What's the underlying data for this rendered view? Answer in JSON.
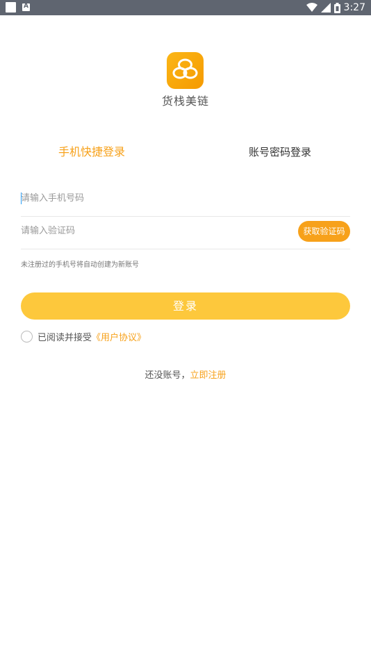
{
  "statusbar": {
    "time": "3:27"
  },
  "brand": {
    "name": "货栈美链"
  },
  "tabs": [
    {
      "label": "手机快捷登录",
      "active": true
    },
    {
      "label": "账号密码登录",
      "active": false
    }
  ],
  "phone": {
    "placeholder": "请输入手机号码",
    "value": ""
  },
  "code": {
    "placeholder": "请输入验证码",
    "value": "",
    "button_label": "获取验证码"
  },
  "hint": "未注册过的手机号将自动创建为新账号",
  "login": {
    "label": "登录"
  },
  "agreement": {
    "prefix": "已阅读并接受",
    "link": "《用户协议》"
  },
  "register": {
    "prefix": "还没账号，",
    "link": "立即注册"
  },
  "colors": {
    "accent": "#f7a11a",
    "button": "#fdc83c",
    "statusbar": "#5f6570"
  }
}
